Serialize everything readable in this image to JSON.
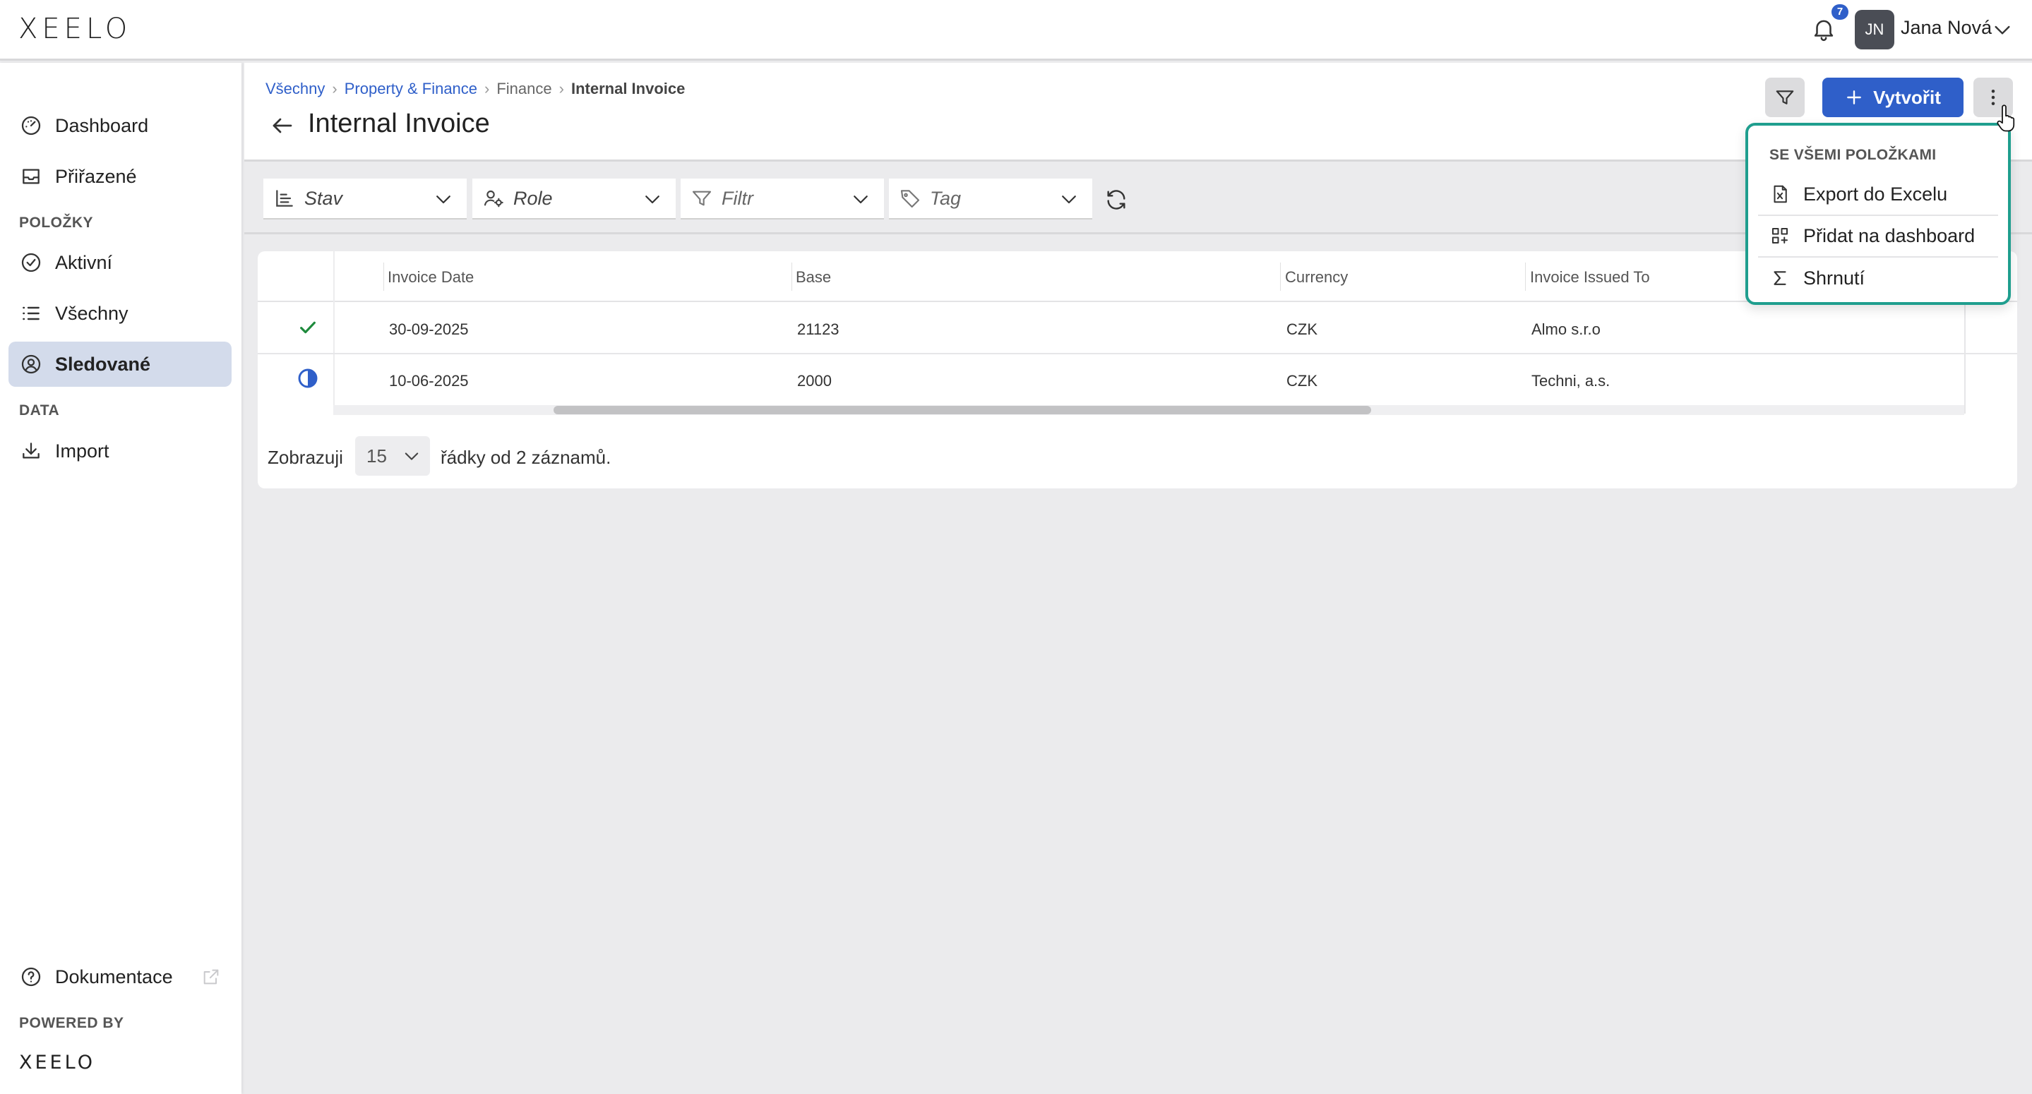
{
  "app": {
    "logo": "XEELO",
    "notification_count": "7",
    "user": {
      "initials": "JN",
      "name": "Jana Nová"
    }
  },
  "sidebar": {
    "items_top": [
      {
        "label": "Dashboard",
        "icon": "gauge-icon"
      },
      {
        "label": "Přiřazené",
        "icon": "inbox-icon"
      }
    ],
    "section_items": "POLOŽKY",
    "items_mid": [
      {
        "label": "Aktivní",
        "icon": "check-circle-icon"
      },
      {
        "label": "Všechny",
        "icon": "list-icon"
      },
      {
        "label": "Sledované",
        "icon": "user-circle-icon",
        "active": true
      }
    ],
    "section_data": "DATA",
    "items_data": [
      {
        "label": "Import",
        "icon": "download-icon"
      }
    ],
    "documentation": "Dokumentace",
    "powered_by": "POWERED BY",
    "powered_logo": "XEELO"
  },
  "header": {
    "breadcrumb": [
      "Všechny",
      "Property & Finance",
      "Finance",
      "Internal Invoice"
    ],
    "title": "Internal Invoice",
    "create_label": "Vytvořit"
  },
  "toolbar": {
    "filters": [
      {
        "label": "Stav",
        "icon": "bar-list-icon"
      },
      {
        "label": "Role",
        "icon": "user-gear-icon"
      },
      {
        "label": "Filtr",
        "icon": "funnel-icon"
      },
      {
        "label": "Tag",
        "icon": "tag-icon"
      }
    ]
  },
  "table": {
    "columns": [
      "Invoice Date",
      "Base",
      "Currency",
      "Invoice Issued To"
    ],
    "rows": [
      {
        "status": "done",
        "cells": [
          "30-09-2025",
          "21123",
          "CZK",
          "Almo s.r.o"
        ]
      },
      {
        "status": "in-progress",
        "cells": [
          "10-06-2025",
          "2000",
          "CZK",
          "Techni, a.s."
        ]
      }
    ]
  },
  "pager": {
    "prefix": "Zobrazuji",
    "page_size": "15",
    "suffix": "řádky od 2 záznamů."
  },
  "menu": {
    "heading": "SE VŠEMI POLOŽKAMI",
    "items": [
      {
        "label": "Export do Excelu",
        "icon": "excel-file-icon"
      },
      {
        "label": "Přidat na dashboard",
        "icon": "dashboard-add-icon"
      },
      {
        "label": "Shrnutí",
        "icon": "sigma-icon"
      }
    ]
  },
  "colors": {
    "accent": "#2f5fc9",
    "menu_border": "#1f9e8e",
    "success": "#1e8a3c",
    "active_nav": "#d3dbeb"
  }
}
